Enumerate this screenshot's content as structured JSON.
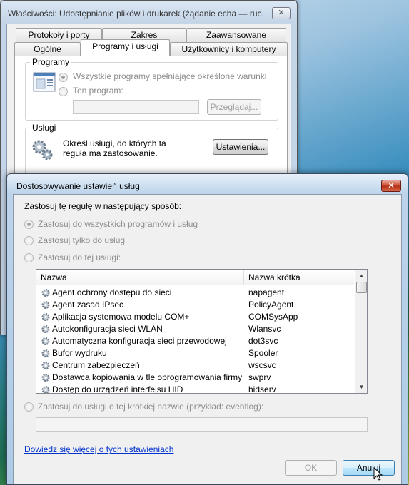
{
  "back_window": {
    "title": "Właściwości: Udostępnianie plików i drukarek (żądanie echa — ruc...",
    "close_glyph": "✕",
    "tabs_row1": [
      "Protokoły i porty",
      "Zakres",
      "Zaawansowane"
    ],
    "tabs_row2": [
      "Ogólne",
      "Programy i usługi",
      "Użytkownicy i komputery"
    ],
    "active_tab": "Programy i usługi",
    "programs_group": {
      "label": "Programy",
      "radio_all": "Wszystkie programy spełniające określone warunki",
      "radio_this": "Ten program:",
      "browse_button": "Przeglądaj..."
    },
    "services_group": {
      "label": "Usługi",
      "description": "Określ usługi, do których ta reguła ma zastosowanie.",
      "settings_button": "Ustawienia..."
    }
  },
  "dialog": {
    "title": "Dostosowywanie ustawień usług",
    "close_glyph": "✕",
    "instruction": "Zastosuj tę regułę w następujący sposób:",
    "radio_all": "Zastosuj do wszystkich programów i usług",
    "radio_services_only": "Zastosuj tylko do usług",
    "radio_this_service": "Zastosuj do tej usługi:",
    "list": {
      "col_name": "Nazwa",
      "col_short": "Nazwa krótka",
      "rows": [
        {
          "name": "Agent ochrony dostępu do sieci",
          "short": "napagent"
        },
        {
          "name": "Agent zasad IPsec",
          "short": "PolicyAgent"
        },
        {
          "name": "Aplikacja systemowa modelu COM+",
          "short": "COMSysApp"
        },
        {
          "name": "Autokonfiguracja sieci WLAN",
          "short": "Wlansvc"
        },
        {
          "name": "Automatyczna konfiguracja sieci przewodowej",
          "short": "dot3svc"
        },
        {
          "name": "Bufor wydruku",
          "short": "Spooler"
        },
        {
          "name": "Centrum zabezpieczeń",
          "short": "wscsvc"
        },
        {
          "name": "Dostawca kopiowania w tle oprogramowania firmy Micr...",
          "short": "swprv"
        },
        {
          "name": "Dostęp do urządzeń interfejsu HID",
          "short": "hidserv"
        }
      ]
    },
    "radio_short_name": "Zastosuj do usługi o tej krótkiej nazwie (przykład: eventlog):",
    "learn_more_link": "Dowiedz się więcej o tych ustawieniach",
    "ok_button": "OK",
    "cancel_button": "Anuluj"
  }
}
